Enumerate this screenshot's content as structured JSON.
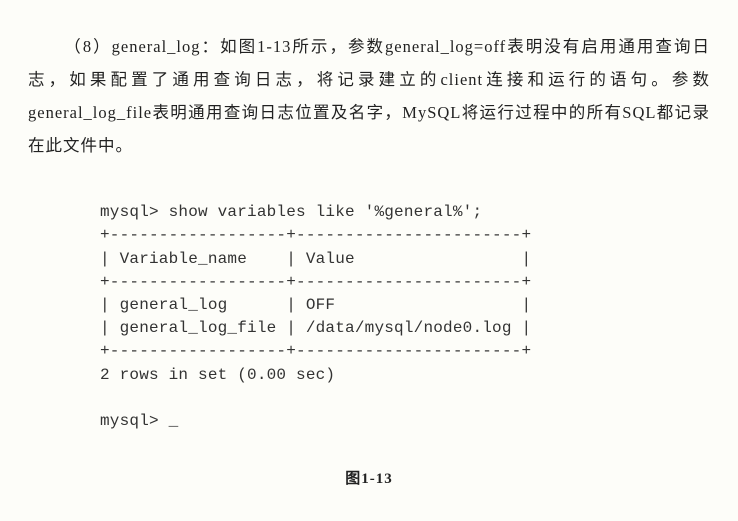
{
  "paragraph": "（8）general_log：如图1-13所示，参数general_log=off表明没有启用通用查询日志，如果配置了通用查询日志，将记录建立的client连接和运行的语句。参数general_log_file表明通用查询日志位置及名字，MySQL将运行过程中的所有SQL都记录在此文件中。",
  "terminal": {
    "cmd": "mysql> show variables like '%general%';",
    "sep_top": "+------------------+-----------------------+",
    "hdr": "| Variable_name    | Value                 |",
    "sep_mid": "+------------------+-----------------------+",
    "row1": "| general_log      | OFF                   |",
    "row2": "| general_log_file | /data/mysql/node0.log |",
    "sep_bot": "+------------------+-----------------------+",
    "status": "2 rows in set (0.00 sec)",
    "prompt2": "mysql> _"
  },
  "caption": "图1-13",
  "chart_data": {
    "type": "table",
    "title": "show variables like '%general%'",
    "columns": [
      "Variable_name",
      "Value"
    ],
    "rows": [
      [
        "general_log",
        "OFF"
      ],
      [
        "general_log_file",
        "/data/mysql/node0.log"
      ]
    ],
    "status": "2 rows in set (0.00 sec)"
  }
}
